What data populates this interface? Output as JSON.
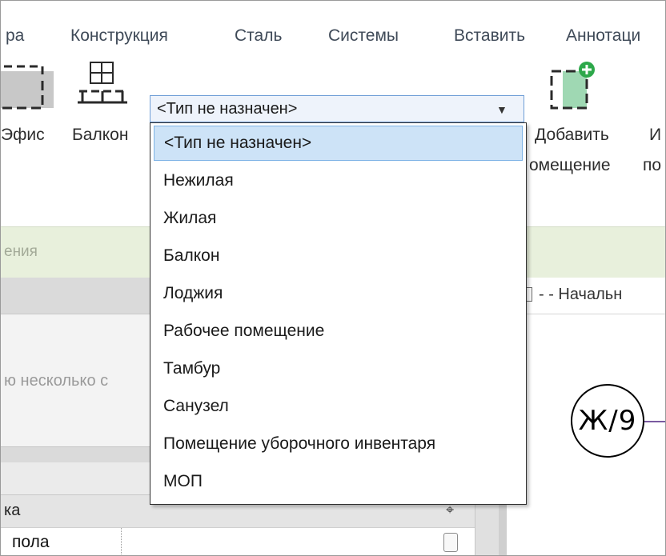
{
  "ribbon_tabs": [
    "ра",
    "Конструкция",
    "Сталь",
    "Системы",
    "Вставить",
    "Аннотаци"
  ],
  "ribbon": {
    "office_label": "Эфис",
    "balcony_label": "Балкон",
    "add_label_1": "Добавить",
    "add_label_2": "омещение",
    "cut_label_1": "И",
    "cut_label_2": "по"
  },
  "panel_title": "ения",
  "dropdown": {
    "value": "<Тип не назначен>",
    "options": [
      "<Тип не назначен>",
      "Нежилая",
      "Жилая",
      "Балкон",
      "Лоджия",
      "Рабочее помещение",
      "Тамбур",
      "Санузел",
      "Помещение уборочного инвентаря",
      "МОП"
    ],
    "selected_index": 0
  },
  "properties": {
    "hint": "ю несколько с",
    "header": "ка",
    "row_label": "пола",
    "pin": "⌖"
  },
  "view": {
    "tab_title": "- - Начальн",
    "grid_label": "Ж/9"
  },
  "colors": {
    "selection": "#cde3f7",
    "panel_title_bg": "#e8f0dc",
    "add_plus": "#2da84a"
  }
}
